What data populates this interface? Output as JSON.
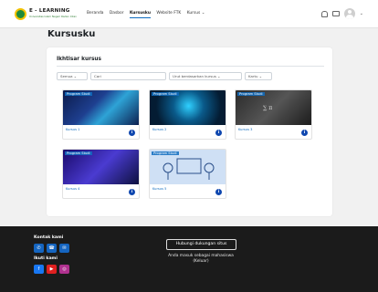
{
  "header": {
    "logo_title": "E - LEARNING",
    "logo_subtitle": "Universitas Islam Negeri Raden Intan",
    "nav": [
      "Beranda",
      "Dasbor",
      "Kursusku",
      "Website FTK",
      "Kursus ⌄"
    ],
    "active_nav_index": 2
  },
  "page": {
    "title": "Kursusku"
  },
  "overview": {
    "title": "Ikhtisar kursus",
    "filter_label": "Semua ⌄",
    "search_placeholder": "Cari",
    "sort_label": "Urut berdasarkan kursus ⌄",
    "view_label": "Kartu ⌄"
  },
  "courses": [
    {
      "tag": "Program Studi",
      "name": "Kursus 1",
      "image": "digital-circuit"
    },
    {
      "tag": "Program Studi",
      "name": "Kursus 2",
      "image": "data-globe"
    },
    {
      "tag": "Program Studi",
      "name": "Kursus 3",
      "image": "math-chalkboard"
    },
    {
      "tag": "Program Studi",
      "name": "Kursus 4",
      "image": "tech-hand"
    },
    {
      "tag": "Program Studi",
      "name": "Kursus 5",
      "image": "learning-illustration"
    }
  ],
  "footer": {
    "contact_heading": "Kontak kami",
    "follow_heading": "Ikuti kami",
    "support_button": "Hubungi dukungan situs",
    "login_info_line1": "Anda masuk sebagai mahasiswa",
    "login_info_line2": "(Keluar)",
    "contact_icons": [
      "whatsapp-icon",
      "phone-icon",
      "email-icon"
    ],
    "social_icons": [
      "facebook-icon",
      "youtube-icon",
      "instagram-icon"
    ]
  },
  "colors": {
    "accent": "#0f6cbf",
    "info_badge": "#0f47af",
    "footer_bg": "#1b1b1b",
    "logo_green": "#1f8a3a"
  }
}
